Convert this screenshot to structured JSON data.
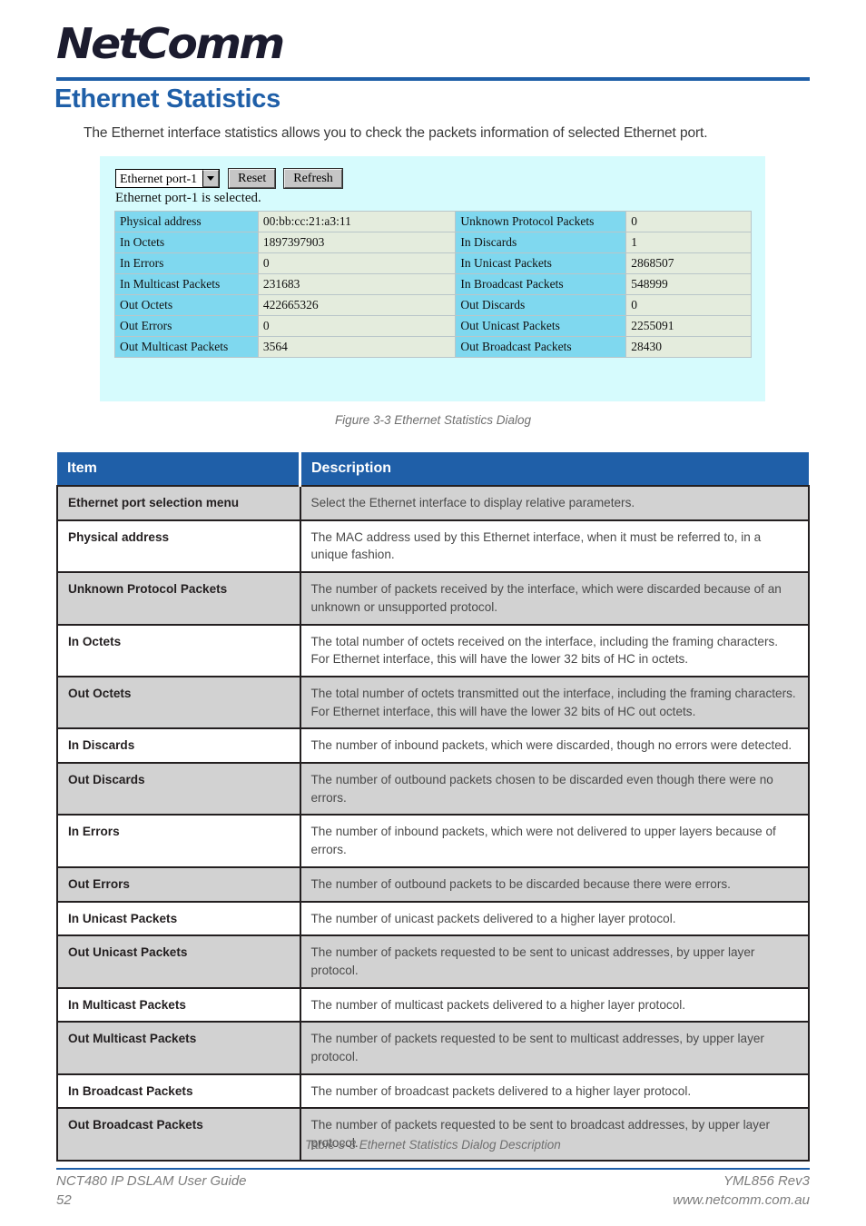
{
  "brand": {
    "logo_text": "NetComm",
    "logo_tm": "™"
  },
  "heading": "Ethernet Statistics",
  "intro": "The Ethernet interface statistics allows you to check the packets information of selected Ethernet port.",
  "colors": {
    "accent_blue": "#1f5fa8",
    "dialog_bg": "#d6fbfd",
    "dialog_label_bg": "#7fd8ef",
    "dialog_value_bg": "#e4ecdd",
    "row_shade": "#d2d2d2"
  },
  "dialog": {
    "port_select_value": "Ethernet port-1",
    "reset_label": "Reset",
    "refresh_label": "Refresh",
    "status_text": "Ethernet port-1 is selected.",
    "rows": [
      {
        "l1": "Physical address",
        "v1": "00:bb:cc:21:a3:11",
        "l2": "Unknown Protocol Packets",
        "v2": "0"
      },
      {
        "l1": "In Octets",
        "v1": "1897397903",
        "l2": "In Discards",
        "v2": "1"
      },
      {
        "l1": "In Errors",
        "v1": "0",
        "l2": "In Unicast Packets",
        "v2": "2868507"
      },
      {
        "l1": "In Multicast Packets",
        "v1": "231683",
        "l2": "In Broadcast Packets",
        "v2": "548999"
      },
      {
        "l1": "Out Octets",
        "v1": "422665326",
        "l2": "Out Discards",
        "v2": "0"
      },
      {
        "l1": "Out Errors",
        "v1": "0",
        "l2": "Out Unicast Packets",
        "v2": "2255091"
      },
      {
        "l1": "Out Multicast Packets",
        "v1": "3564",
        "l2": "Out Broadcast Packets",
        "v2": "28430"
      }
    ]
  },
  "figure_caption": "Figure 3-3 Ethernet Statistics Dialog",
  "table_caption": "Table 3-3 Ethernet Statistics Dialog Description",
  "desc_table": {
    "headers": {
      "item": "Item",
      "description": "Description"
    },
    "rows": [
      {
        "shaded": true,
        "item": "Ethernet port selection menu",
        "description": "Select the Ethernet interface to display relative parameters."
      },
      {
        "shaded": false,
        "item": "Physical address",
        "description": "The MAC address used by this Ethernet interface, when it must be referred to, in a unique fashion."
      },
      {
        "shaded": true,
        "item": "Unknown Protocol Packets",
        "description": "The number of packets received by the interface, which were discarded because of an unknown or unsupported protocol."
      },
      {
        "shaded": false,
        "item": "In Octets",
        "description": "The total number of octets received on the interface, including the framing characters. For Ethernet interface, this will have the lower 32 bits of HC in octets."
      },
      {
        "shaded": true,
        "item": "Out Octets",
        "description": "The total number of octets transmitted out the interface, including the framing characters. For Ethernet interface, this will have the lower 32 bits of HC out octets."
      },
      {
        "shaded": false,
        "item": "In Discards",
        "description": "The number of inbound packets, which were discarded, though no errors were detected."
      },
      {
        "shaded": true,
        "item": "Out Discards",
        "description": "The number of outbound packets chosen to be discarded even though there were no errors."
      },
      {
        "shaded": false,
        "item": "In Errors",
        "description": "The number of inbound packets, which were not delivered to upper layers because of errors."
      },
      {
        "shaded": true,
        "item": "Out Errors",
        "description": "The number of outbound packets to be discarded because there were errors."
      },
      {
        "shaded": false,
        "item": "In Unicast Packets",
        "description": "The number of unicast packets delivered to a higher layer protocol."
      },
      {
        "shaded": true,
        "item": "Out Unicast Packets",
        "description": "The number of packets requested to be sent to unicast addresses, by upper layer protocol."
      },
      {
        "shaded": false,
        "item": "In Multicast Packets",
        "description": "The number of multicast packets delivered to a higher layer protocol."
      },
      {
        "shaded": true,
        "item": "Out Multicast Packets",
        "description": "The number of packets requested to be sent to multicast addresses, by upper layer protocol."
      },
      {
        "shaded": false,
        "item": "In Broadcast Packets",
        "description": "The number of broadcast packets delivered to a higher layer protocol."
      },
      {
        "shaded": true,
        "item": "Out Broadcast Packets",
        "description": "The number of packets requested to be sent to broadcast addresses, by upper layer protocol."
      }
    ]
  },
  "footer": {
    "guide_title": "NCT480 IP DSLAM User Guide",
    "page_number": "52",
    "doc_code": "YML856 Rev3",
    "website": "www.netcomm.com.au"
  }
}
